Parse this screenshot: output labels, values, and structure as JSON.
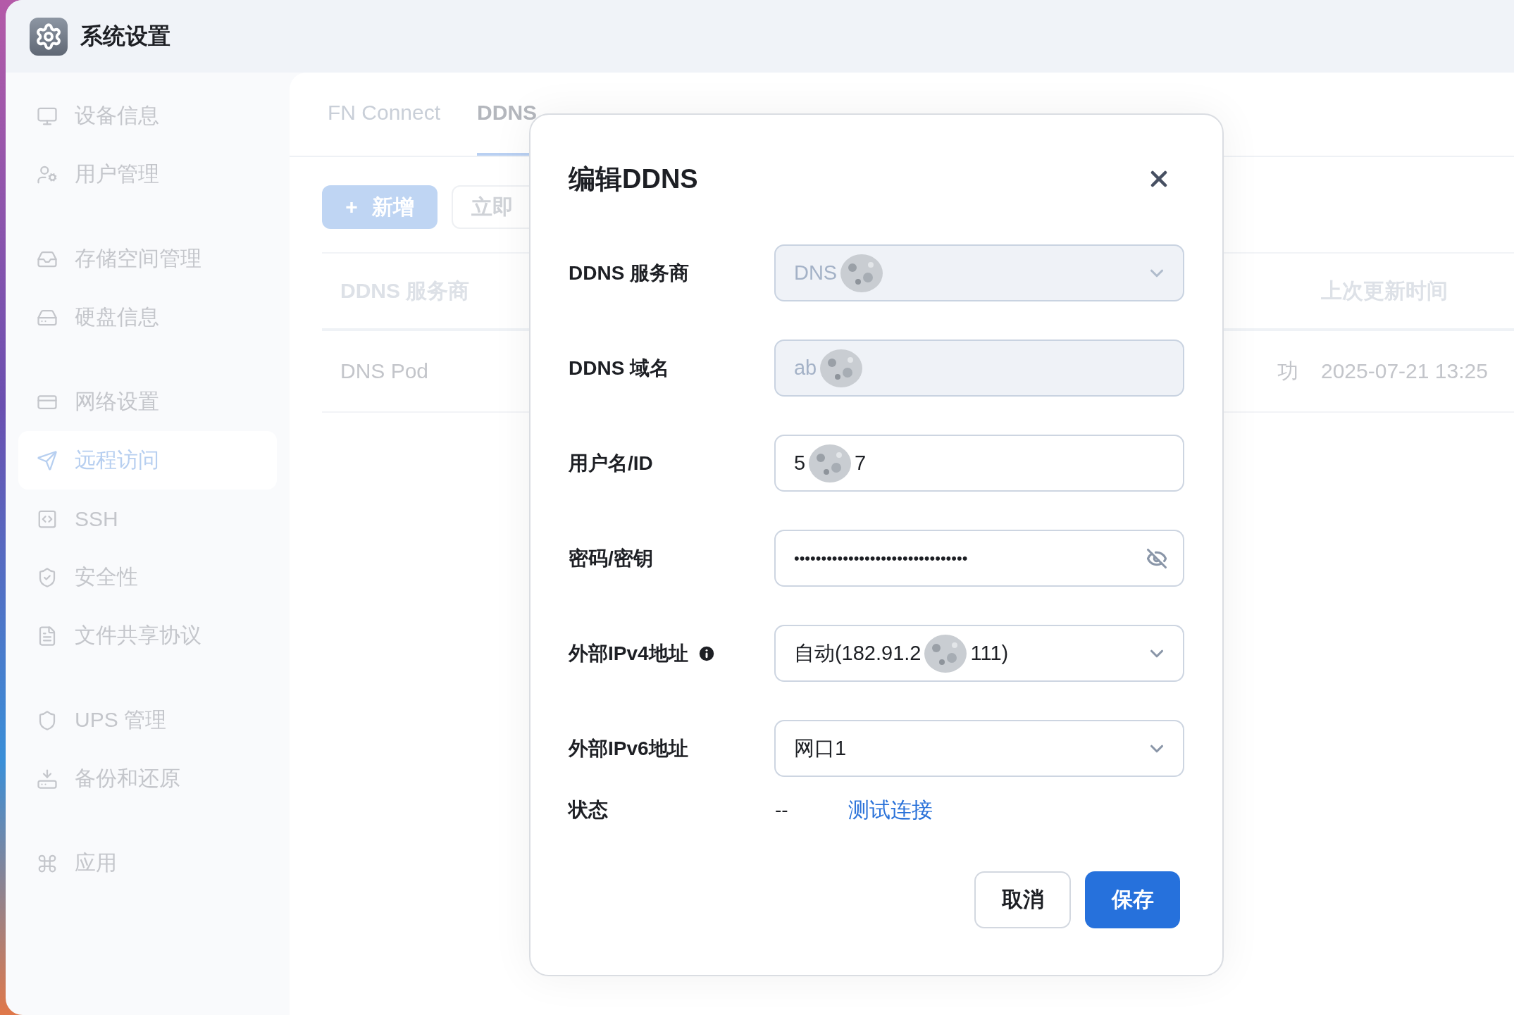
{
  "window": {
    "title": "系统设置"
  },
  "sidebar": {
    "groups": [
      [
        {
          "label": "设备信息",
          "selected": false
        },
        {
          "label": "用户管理",
          "selected": false
        }
      ],
      [
        {
          "label": "存储空间管理",
          "selected": false
        },
        {
          "label": "硬盘信息",
          "selected": false
        }
      ],
      [
        {
          "label": "网络设置",
          "selected": false
        },
        {
          "label": "远程访问",
          "selected": true
        },
        {
          "label": "SSH",
          "selected": false
        },
        {
          "label": "安全性",
          "selected": false
        },
        {
          "label": "文件共享协议",
          "selected": false
        }
      ],
      [
        {
          "label": "UPS 管理",
          "selected": false
        },
        {
          "label": "备份和还原",
          "selected": false
        }
      ],
      [
        {
          "label": "应用",
          "selected": false
        }
      ]
    ]
  },
  "tabs": [
    {
      "label": "FN Connect",
      "selected": false
    },
    {
      "label": "DDNS",
      "selected": true
    }
  ],
  "toolbar": {
    "add_button": {
      "icon": "+",
      "label": "新增"
    },
    "update_button": "立即"
  },
  "table": {
    "columns": [
      "DDNS 服务商",
      "上次更新时间"
    ],
    "rows": [
      {
        "provider": "DNS Pod",
        "status": "功",
        "updated": "2025-07-21 13:25"
      }
    ]
  },
  "dialog": {
    "title": "编辑DDNS",
    "fields": [
      {
        "label": "DDNS 服务商",
        "kind": "select",
        "disabled": true,
        "value": "DNS",
        "redacted": true
      },
      {
        "label": "DDNS 域名",
        "kind": "input",
        "disabled": true,
        "value": "ab",
        "redacted": true
      },
      {
        "label": "用户名/ID",
        "kind": "input",
        "disabled": false,
        "value": "5",
        "value_end": "7",
        "redacted": true
      },
      {
        "label": "密码/密钥",
        "kind": "password",
        "disabled": false,
        "value": "••••••••••••••••••••••••••••••••"
      },
      {
        "label": "外部IPv4地址",
        "kind": "select",
        "disabled": false,
        "info": true,
        "value": "自动(182.91.2",
        "value_end": "111)",
        "redacted": true
      },
      {
        "label": "外部IPv6地址",
        "kind": "select",
        "disabled": false,
        "value": "网口1"
      }
    ],
    "status": {
      "label": "状态",
      "value": "--",
      "link": "测试连接"
    },
    "buttons": {
      "cancel": "取消",
      "save": "保存"
    }
  }
}
